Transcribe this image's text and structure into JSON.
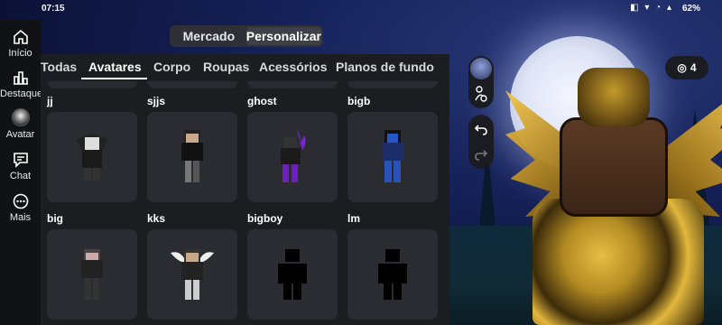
{
  "status_bar": {
    "time": "07:15",
    "icons": "◧ ▾ ◔ ▴",
    "battery": "62%"
  },
  "nav": {
    "items": [
      {
        "label": "Início",
        "icon": "home-icon"
      },
      {
        "label": "Destaques",
        "icon": "chart-icon"
      },
      {
        "label": "Avatar",
        "icon": "avatar-icon"
      },
      {
        "label": "Chat",
        "icon": "chat-icon"
      },
      {
        "label": "Mais",
        "icon": "more-icon"
      }
    ]
  },
  "mode_toggle": {
    "market": "Mercado",
    "customize": "Personalizar",
    "selected": "Personalizar"
  },
  "tabs": [
    "Todas",
    "Avatares",
    "Corpo",
    "Roupas",
    "Acessórios",
    "Planos de fundo"
  ],
  "active_tab": "Avatares",
  "outfits": [
    {
      "name": "jj"
    },
    {
      "name": "sjjs"
    },
    {
      "name": "ghost"
    },
    {
      "name": "bigb"
    },
    {
      "name": "big"
    },
    {
      "name": "kks"
    },
    {
      "name": "bigboy"
    },
    {
      "name": "lm"
    }
  ],
  "counter": {
    "value": "4",
    "icon": "stack-icon"
  },
  "colors": {
    "accent": "#ffffff",
    "panel": "#1c1d21",
    "card": "#2b2c31"
  }
}
